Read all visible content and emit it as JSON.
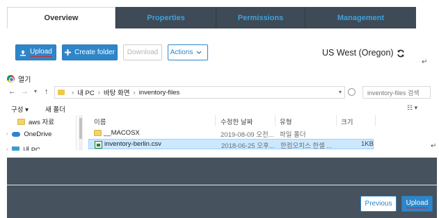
{
  "tabs": [
    {
      "label": "Overview",
      "active": true
    },
    {
      "label": "Properties",
      "active": false
    },
    {
      "label": "Permissions",
      "active": false
    },
    {
      "label": "Management",
      "active": false
    }
  ],
  "toolbar": {
    "upload_label": "Upload",
    "create_folder_label": "Create folder",
    "download_label": "Download",
    "actions_label": "Actions",
    "region": "US West (Oregon)"
  },
  "return_glyph": "↵",
  "dialog": {
    "title": "열기",
    "path": [
      "내 PC",
      "바탕 화면",
      "inventory-files"
    ],
    "search_placeholder": "inventory-files 검색",
    "organize_label": "구성 ▾",
    "new_folder_label": "새 폴더",
    "columns": [
      "이름",
      "수정한 날짜",
      "유형",
      "크기"
    ],
    "tree": [
      {
        "label": "aws 자료",
        "icon": "folder-icon"
      },
      {
        "label": "OneDrive",
        "icon": "cloud-icon"
      },
      {
        "label": "내 PC",
        "icon": "computer-icon"
      }
    ],
    "files": [
      {
        "name": "__MACOSX",
        "date": "2019-08-09 오전...",
        "type": "파일 폴더",
        "size": "",
        "icon": "folder-icon",
        "selected": false
      },
      {
        "name": "inventory-berlin.csv",
        "date": "2018-06-25 오후...",
        "type": "한컴오피스 한셀 ...",
        "size": "1KB",
        "icon": "csv-file-icon",
        "selected": true
      }
    ]
  },
  "footer": {
    "previous_label": "Previous",
    "upload_label": "Upload"
  },
  "colors": {
    "primary": "#2e86c9",
    "tab_dark": "#3e4a55",
    "footer_bg": "#46525d",
    "selection": "#cce8ff",
    "underline": "#d8261f"
  }
}
